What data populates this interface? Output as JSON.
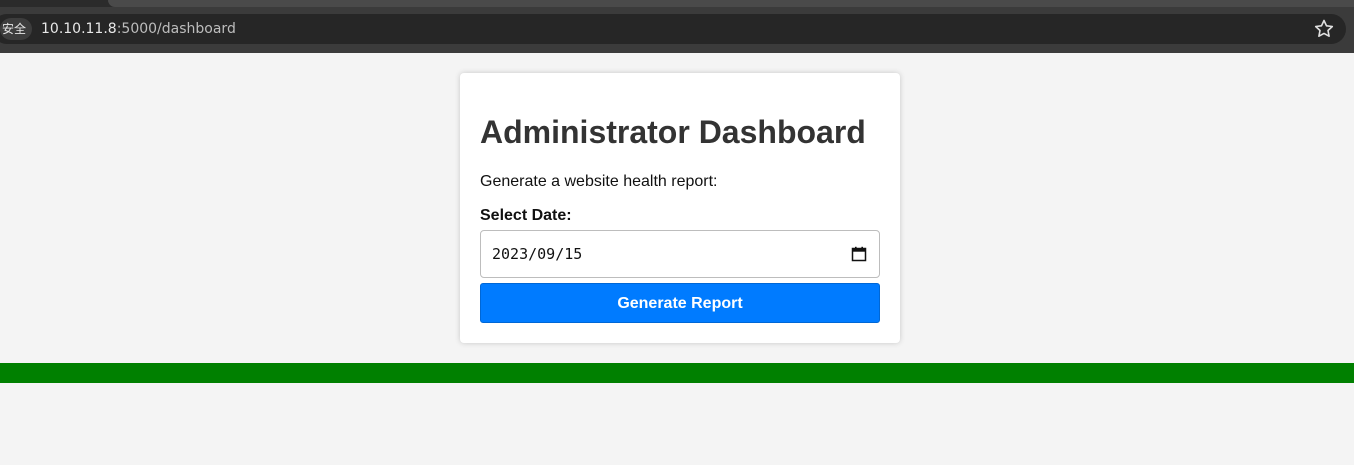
{
  "browser": {
    "security_label": "安全",
    "url_host": "10.10.11.8",
    "url_path": ":5000/dashboard"
  },
  "dashboard": {
    "title": "Administrator Dashboard",
    "description": "Generate a website health report:",
    "date_label": "Select Date:",
    "date_value": "2023/09/15",
    "button_label": "Generate Report"
  },
  "colors": {
    "button": "#007bff",
    "status_bar": "#008000",
    "page_background": "#f4f4f4"
  },
  "icons": {
    "bookmark": "star-icon",
    "date_picker": "calendar-icon"
  }
}
